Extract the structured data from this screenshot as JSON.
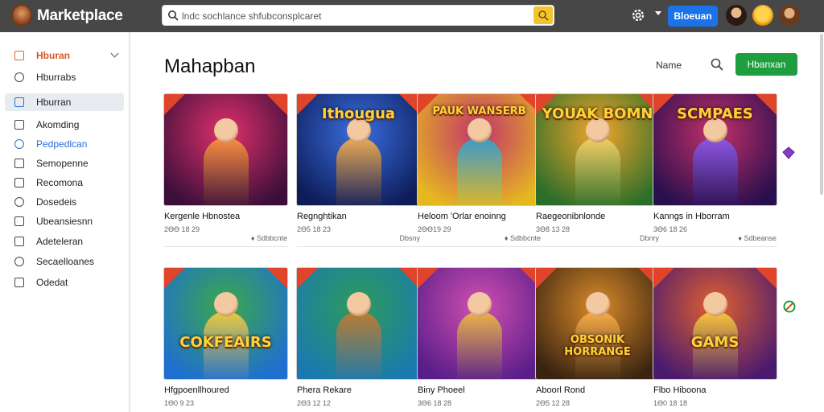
{
  "topbar": {
    "brand": "Marketplace",
    "search_value": "lndc sochlance shfubconsplcaret",
    "action_label": "Bloeuan"
  },
  "sidebar": {
    "items": [
      {
        "label": "Hburan",
        "active": true
      },
      {
        "label": "Hburrabs"
      },
      {
        "label": "Hburran",
        "selected": true
      },
      {
        "label": "Akomding"
      },
      {
        "label": "Pedpedlcan",
        "highlight": true
      },
      {
        "label": "Semopenne"
      },
      {
        "label": "Recomona"
      },
      {
        "label": "Dosedeis"
      },
      {
        "label": "Ubeansiesnn"
      },
      {
        "label": "Adeteleran"
      },
      {
        "label": "Secaelloanes"
      },
      {
        "label": "Odedat"
      }
    ]
  },
  "main": {
    "title": "Mahapban",
    "sort_label": "Name",
    "primary_button": "Hbanxan"
  },
  "cards": [
    {
      "title": "Kergenle Hbnostea",
      "meta": "2ӨӨ 18 29",
      "extra": "♦ Sdbbcnte",
      "colors": [
        "#3b0f3a",
        "#e0306b"
      ],
      "accent": "#ff9a3c",
      "art": ""
    },
    {
      "title": "Regnghtikan",
      "meta": "2Ө5 18 23",
      "extra": "Dbsny",
      "colors": [
        "#0e1d5a",
        "#3a6fe0"
      ],
      "accent": "#ffb347",
      "art": "Ithougua"
    },
    {
      "title": "Heloom 'Orlar enoinng",
      "meta": "2ӨӨ19 29",
      "extra": "♦ Sdbbcnte",
      "colors": [
        "#e6b820",
        "#c2346a"
      ],
      "accent": "#2aa3d8",
      "art": "PAUK WANSERB"
    },
    {
      "title": "Raegeonibnlonde",
      "meta": "3Ө8 13 28",
      "extra": "Dbnry",
      "colors": [
        "#2b6e2a",
        "#f2a52b"
      ],
      "accent": "#f7d36b",
      "art": "YOUAK BOMN"
    },
    {
      "title": "Kanngs in Hborram",
      "meta": "3Ө6 18 26",
      "extra": "♦ Sdbeanse",
      "colors": [
        "#2a0f4e",
        "#c2306a"
      ],
      "accent": "#8a5cf0",
      "art": "SCMPAES"
    },
    {
      "title": "Hfgpoenllhoured",
      "meta": "1Ө0 9 23",
      "extra": "",
      "colors": [
        "#1f6fd0",
        "#3aa84a"
      ],
      "accent": "#ffcf3a",
      "art": "COKFEAIRS"
    },
    {
      "title": "Phera Rekare",
      "meta": "2Ө3 12 12",
      "extra": "",
      "colors": [
        "#1a7ab0",
        "#2e9a5a"
      ],
      "accent": "#c97a2a",
      "art": ""
    },
    {
      "title": "Biny Phoeel",
      "meta": "3Ө6 18 28",
      "extra": "",
      "colors": [
        "#5a1e8a",
        "#d14fb0"
      ],
      "accent": "#f0c040",
      "art": ""
    },
    {
      "title": "Aboorl Rond",
      "meta": "2Ө5 12 28",
      "extra": "",
      "colors": [
        "#3a2410",
        "#d98a2a"
      ],
      "accent": "#ffb34d",
      "art": "OBSONIK HORRANGE"
    },
    {
      "title": "Flbo Hiboona",
      "meta": "1Ө0 18 18",
      "extra": "",
      "colors": [
        "#4a1a6e",
        "#e06030"
      ],
      "accent": "#ffd23a",
      "art": "GAMS"
    }
  ]
}
